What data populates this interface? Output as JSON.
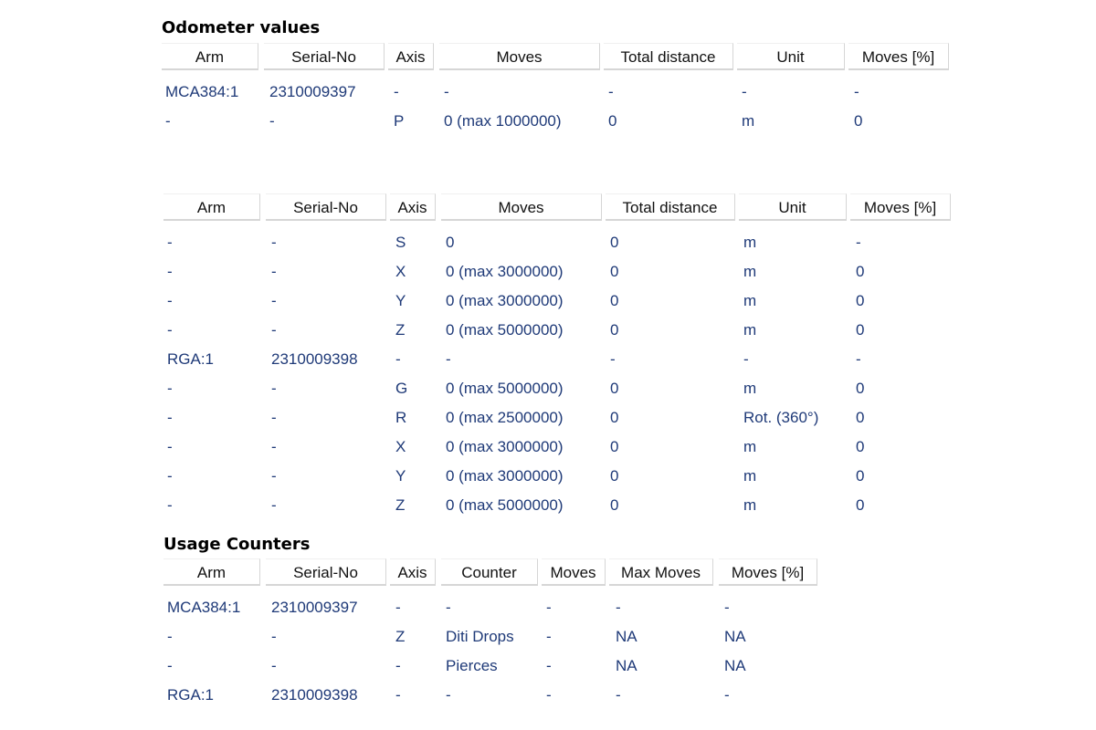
{
  "odometer": {
    "title": "Odometer values",
    "columns": [
      "Arm",
      "Serial-No",
      "Axis",
      "Moves",
      "Total distance",
      "Unit",
      "Moves [%]"
    ],
    "table1": [
      [
        "MCA384:1",
        "2310009397",
        "-",
        "-",
        "-",
        "-",
        "-"
      ],
      [
        "-",
        "-",
        "P",
        "0 (max 1000000)",
        "0",
        "m",
        "0"
      ]
    ],
    "table2": [
      [
        "-",
        "-",
        "S",
        "0",
        "0",
        "m",
        "-"
      ],
      [
        "-",
        "-",
        "X",
        "0 (max 3000000)",
        "0",
        "m",
        "0"
      ],
      [
        "-",
        "-",
        "Y",
        "0 (max 3000000)",
        "0",
        "m",
        "0"
      ],
      [
        "-",
        "-",
        "Z",
        "0 (max 5000000)",
        "0",
        "m",
        "0"
      ],
      [
        "RGA:1",
        "2310009398",
        "-",
        "-",
        "-",
        "-",
        "-"
      ],
      [
        "-",
        "-",
        "G",
        "0 (max 5000000)",
        "0",
        "m",
        "0"
      ],
      [
        "-",
        "-",
        "R",
        "0 (max 2500000)",
        "0",
        "Rot. (360°)",
        "0"
      ],
      [
        "-",
        "-",
        "X",
        "0 (max 3000000)",
        "0",
        "m",
        "0"
      ],
      [
        "-",
        "-",
        "Y",
        "0 (max 3000000)",
        "0",
        "m",
        "0"
      ],
      [
        "-",
        "-",
        "Z",
        "0 (max 5000000)",
        "0",
        "m",
        "0"
      ]
    ]
  },
  "usage": {
    "title": "Usage Counters",
    "columns": [
      "Arm",
      "Serial-No",
      "Axis",
      "Counter",
      "Moves",
      "Max Moves",
      "Moves [%]"
    ],
    "rows": [
      [
        "MCA384:1",
        "2310009397",
        "-",
        "-",
        "-",
        "-",
        "-"
      ],
      [
        "-",
        "-",
        "Z",
        "Diti Drops",
        "-",
        "NA",
        "NA"
      ],
      [
        "-",
        "-",
        "-",
        "Pierces",
        "-",
        "NA",
        "NA"
      ],
      [
        "RGA:1",
        "2310009398",
        "-",
        "-",
        "-",
        "-",
        "-"
      ]
    ]
  }
}
